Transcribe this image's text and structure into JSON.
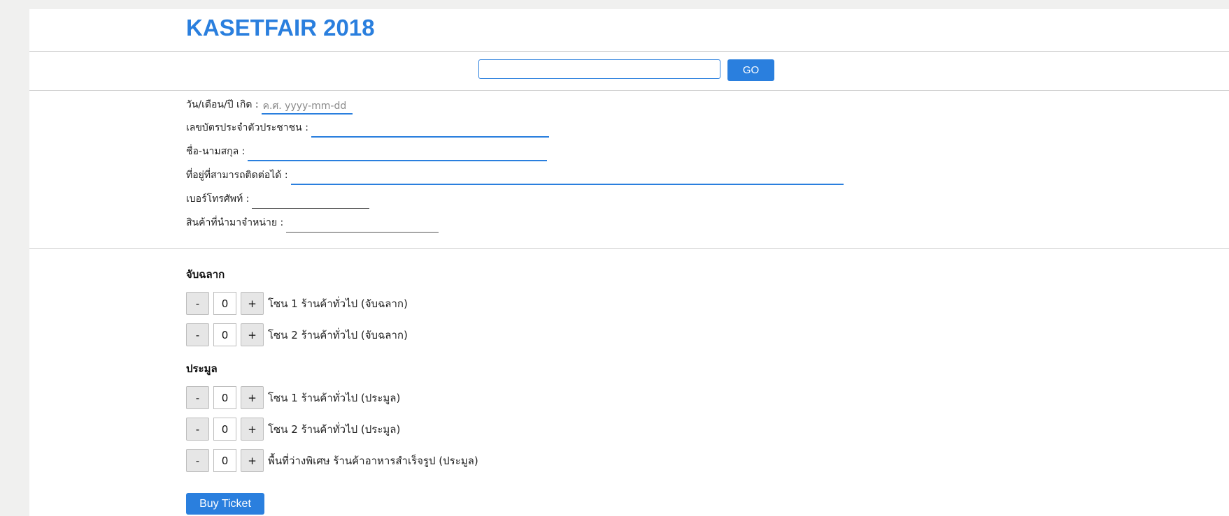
{
  "header": {
    "brand": "KASETFAIR 2018"
  },
  "search": {
    "value": "",
    "go_label": "GO"
  },
  "form": {
    "birthdate_label": "วัน/เดือน/ปี เกิด :",
    "birthdate_placeholder": "ค.ศ. yyyy-mm-dd",
    "id_card_label": "เลขบัตรประจำตัวประชาชน :",
    "name_label": "ชื่อ-นามสกุล :",
    "address_label": "ที่อยู่ที่สามารถติดต่อได้ :",
    "phone_label": "เบอร์โทรศัพท์ :",
    "product_label": "สินค้าที่นำมาจำหน่าย :"
  },
  "lottery": {
    "title": "จับฉลาก",
    "items": [
      {
        "minus": "-",
        "value": "0",
        "plus": "+",
        "label": "โซน 1 ร้านค้าทั่วไป (จับฉลาก)"
      },
      {
        "minus": "-",
        "value": "0",
        "plus": "+",
        "label": "โซน 2 ร้านค้าทั่วไป (จับฉลาก)"
      }
    ]
  },
  "auction": {
    "title": "ประมูล",
    "items": [
      {
        "minus": "-",
        "value": "0",
        "plus": "+",
        "label": "โซน 1 ร้านค้าทั่วไป (ประมูล)"
      },
      {
        "minus": "-",
        "value": "0",
        "plus": "+",
        "label": "โซน 2 ร้านค้าทั่วไป (ประมูล)"
      },
      {
        "minus": "-",
        "value": "0",
        "plus": "+",
        "label": "พื้นที่ว่างพิเศษ ร้านค้าอาหารสำเร็จรูป (ประมูล)"
      }
    ]
  },
  "actions": {
    "buy_label": "Buy Ticket"
  },
  "colors": {
    "accent": "#2a7fde",
    "background": "#f0f0ef"
  }
}
